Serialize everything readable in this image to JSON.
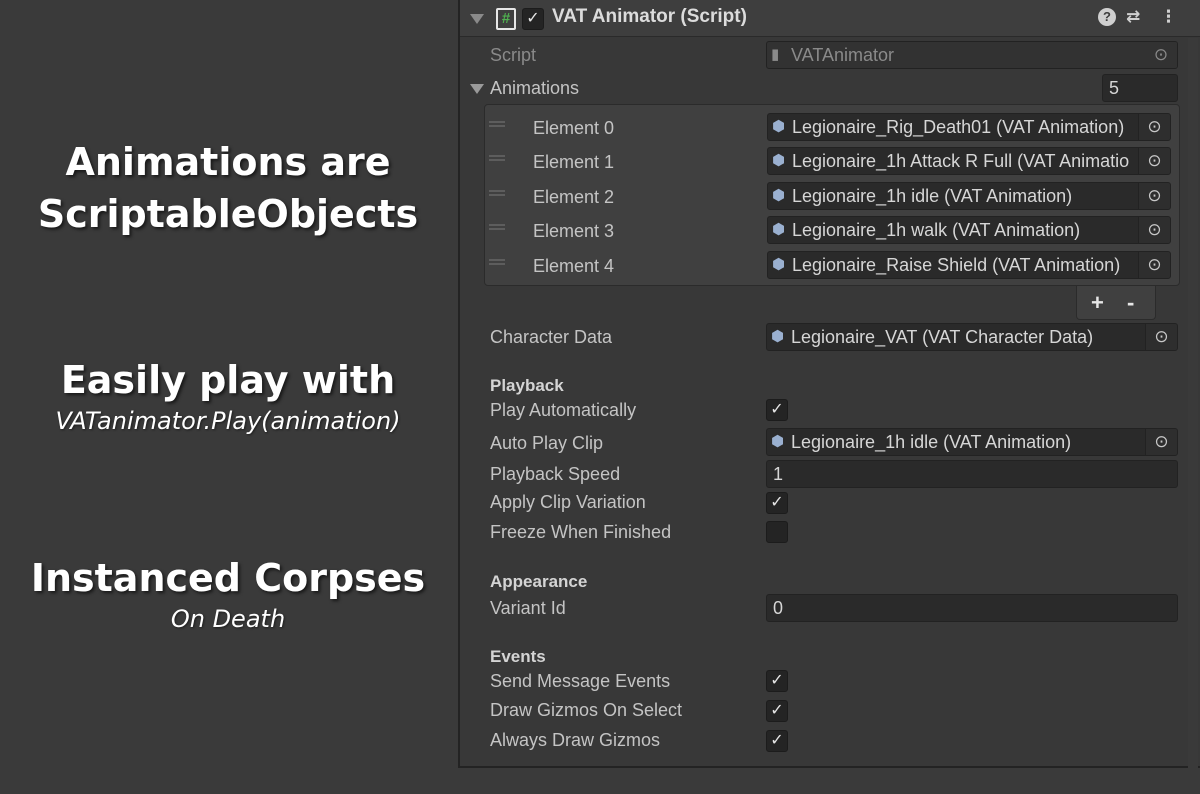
{
  "captions": {
    "c1_line1": "Animations are",
    "c1_line2": "ScriptableObjects",
    "c2_big": "Easily play with",
    "c2_small": "VATanimator.Play(animation)",
    "c3_big": "Instanced Corpses",
    "c3_small": "On Death"
  },
  "component": {
    "title": "VAT Animator (Script)",
    "enabled_mark": "✓",
    "script_icon": "#",
    "script_label": "Script",
    "script_value": "VATAnimator"
  },
  "animations": {
    "label": "Animations",
    "size": "5",
    "elements": [
      {
        "label": "Element 0",
        "value": "Legionaire_Rig_Death01 (VAT Animation)"
      },
      {
        "label": "Element 1",
        "value": "Legionaire_1h Attack R Full (VAT Animatio"
      },
      {
        "label": "Element 2",
        "value": "Legionaire_1h idle (VAT Animation)"
      },
      {
        "label": "Element 3",
        "value": "Legionaire_1h walk (VAT Animation)"
      },
      {
        "label": "Element 4",
        "value": "Legionaire_Raise Shield (VAT Animation)"
      }
    ],
    "add": "+",
    "remove": "-"
  },
  "character_data": {
    "label": "Character Data",
    "value": "Legionaire_VAT (VAT Character Data)"
  },
  "playback": {
    "header": "Playback",
    "play_auto_label": "Play Automatically",
    "play_auto": "✓",
    "auto_clip_label": "Auto Play Clip",
    "auto_clip_value": "Legionaire_1h idle (VAT Animation)",
    "speed_label": "Playback Speed",
    "speed_value": "1",
    "variation_label": "Apply Clip Variation",
    "variation": "✓",
    "freeze_label": "Freeze When Finished",
    "freeze": ""
  },
  "appearance": {
    "header": "Appearance",
    "variant_label": "Variant Id",
    "variant_value": "0"
  },
  "events": {
    "header": "Events",
    "send_label": "Send Message Events",
    "send": "✓",
    "draw_select_label": "Draw Gizmos On Select",
    "draw_select": "✓",
    "always_label": "Always Draw Gizmos",
    "always": "✓"
  },
  "icons": {
    "help": "?",
    "presets": "⇄",
    "menu": "⋮",
    "picker": "⊙",
    "asset": "⬢",
    "script_file": "▮"
  }
}
